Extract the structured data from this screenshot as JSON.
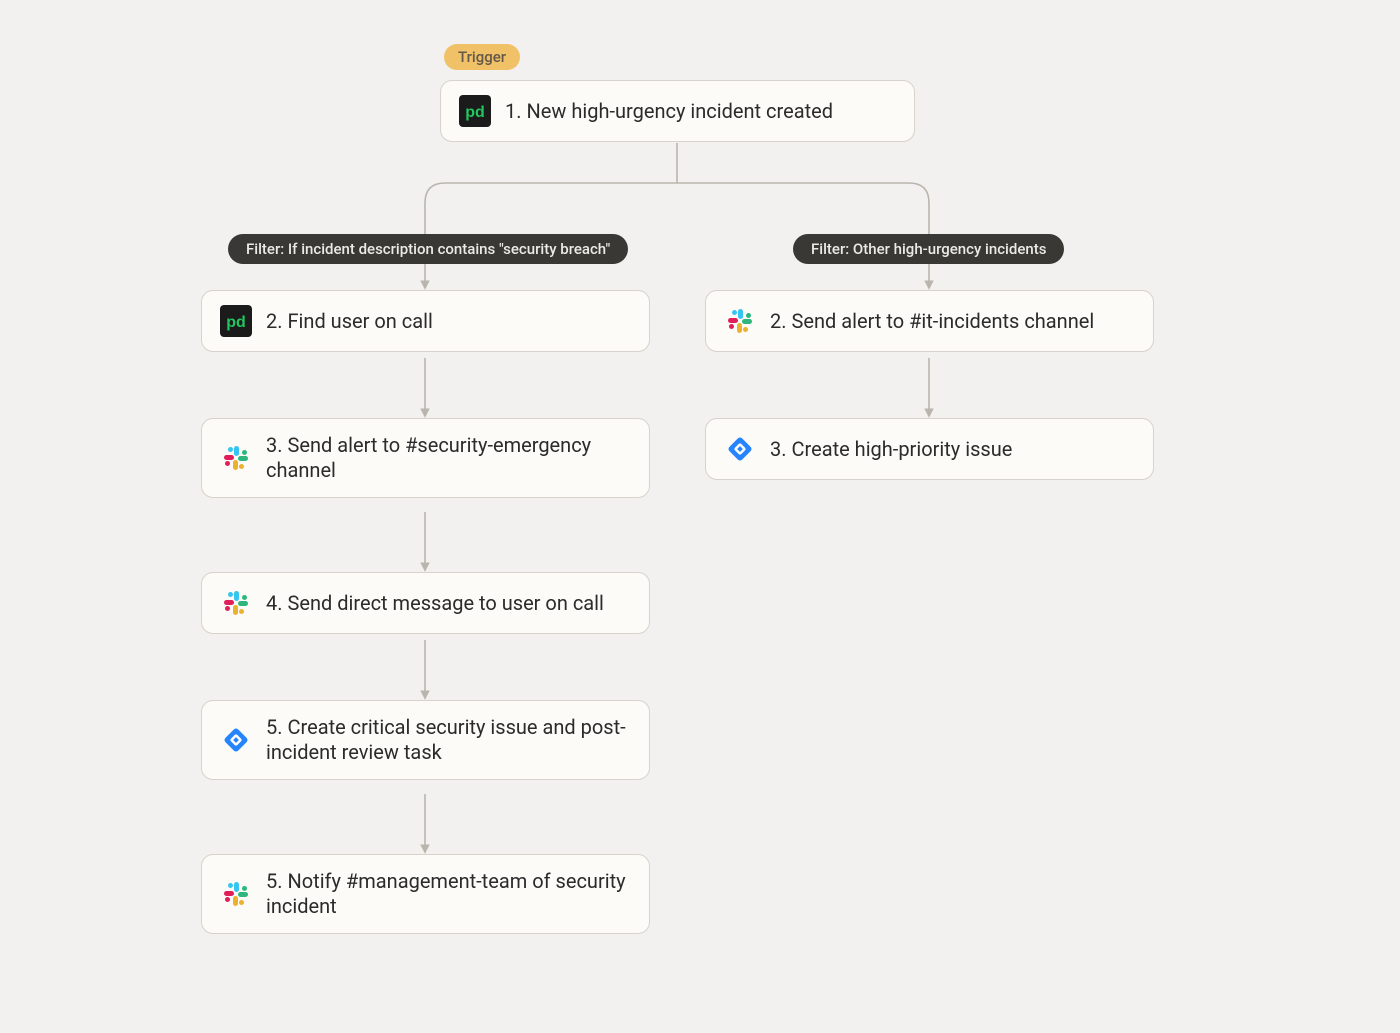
{
  "trigger_label": "Trigger",
  "root_step": {
    "label": "1. New high-urgency incident created",
    "icon": "pagerduty"
  },
  "branches": {
    "left": {
      "filter_label": "Filter: If incident description contains \"security breach\"",
      "steps": [
        {
          "label": "2. Find user on call",
          "icon": "pagerduty"
        },
        {
          "label": "3. Send alert to #security-emergency channel",
          "icon": "slack"
        },
        {
          "label": "4. Send direct message to user on call",
          "icon": "slack"
        },
        {
          "label": "5. Create critical security issue and post-incident review task",
          "icon": "jira"
        },
        {
          "label": "5. Notify #management-team of security incident",
          "icon": "slack"
        }
      ]
    },
    "right": {
      "filter_label": "Filter: Other high-urgency incidents",
      "steps": [
        {
          "label": "2. Send alert to #it-incidents channel",
          "icon": "slack"
        },
        {
          "label": "3. Create high-priority issue",
          "icon": "jira"
        }
      ]
    }
  }
}
